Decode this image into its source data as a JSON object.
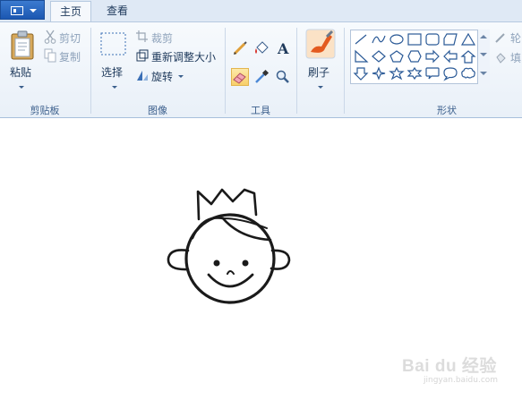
{
  "tabs": {
    "app_menu": "app-menu",
    "home": "主页",
    "view": "查看"
  },
  "clipboard": {
    "paste": "粘贴",
    "cut": "剪切",
    "copy": "复制",
    "group": "剪贴板"
  },
  "image": {
    "select": "选择",
    "crop": "裁剪",
    "resize": "重新调整大小",
    "rotate": "旋转",
    "group": "图像"
  },
  "tools": {
    "group": "工具",
    "items": [
      "pencil-icon",
      "fill-icon",
      "text-icon",
      "eraser-icon",
      "color-picker-icon",
      "magnifier-icon"
    ],
    "active": "eraser-icon"
  },
  "brushes": {
    "label": "刷子"
  },
  "shapes": {
    "group": "形状",
    "outline_partial": "轮",
    "fill_partial": "填",
    "items": [
      "line",
      "curve",
      "oval",
      "rectangle",
      "rounded-rectangle",
      "polygon",
      "triangle",
      "right-triangle",
      "diamond",
      "pentagon",
      "hexagon",
      "arrow-right",
      "arrow-left",
      "arrow-up",
      "arrow-down",
      "star-4",
      "star-5",
      "star-6",
      "callout-rounded",
      "callout-oval",
      "callout-cloud"
    ]
  },
  "canvas": {
    "drawing": "cartoon-boy-with-crown"
  },
  "watermark": {
    "main": "Bai du 经验",
    "sub": "jingyan.baidu.com"
  },
  "colors": {
    "ribbon": "#eef3fa",
    "tab_strip": "#dfe9f5",
    "accent": "#1b57b1",
    "active_tool": "#f8cf6a"
  }
}
